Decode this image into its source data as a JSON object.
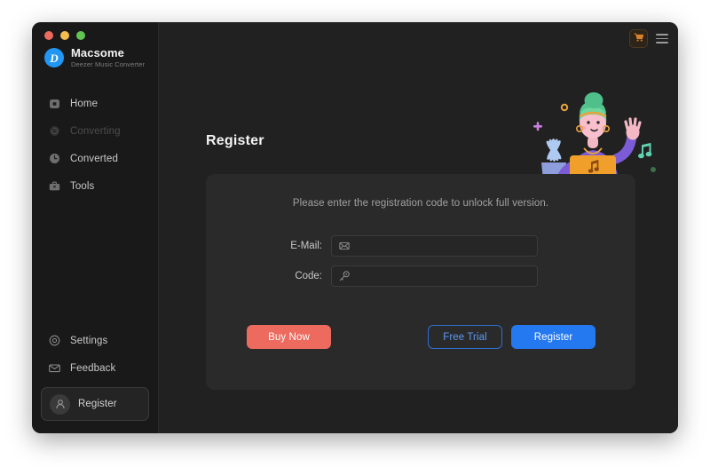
{
  "window": {
    "traffic_lights": [
      {
        "name": "close",
        "color": "#ec6a5e"
      },
      {
        "name": "minimize",
        "color": "#f4bd4f"
      },
      {
        "name": "maximize",
        "color": "#61c554"
      }
    ]
  },
  "sidebar": {
    "brand": {
      "logo_letter": "D",
      "name": "Macsome",
      "subtitle": "Deezer Music Converter",
      "logo_color": "#2196f3"
    },
    "nav_top": [
      {
        "label": "Home",
        "icon": "home-icon",
        "state": "normal"
      },
      {
        "label": "Converting",
        "icon": "converting-icon",
        "state": "disabled"
      },
      {
        "label": "Converted",
        "icon": "converted-icon",
        "state": "normal"
      },
      {
        "label": "Tools",
        "icon": "tools-icon",
        "state": "normal"
      }
    ],
    "nav_bottom": [
      {
        "label": "Settings",
        "icon": "settings-icon"
      },
      {
        "label": "Feedback",
        "icon": "feedback-icon"
      }
    ],
    "register_nav": {
      "label": "Register",
      "icon": "user-avatar-icon"
    }
  },
  "topbar": {
    "cart_icon": "shopping-cart-icon",
    "menu_icon": "hamburger-menu-icon",
    "cart_color": "#d9822b"
  },
  "main": {
    "page_title": "Register",
    "illustration": "person-waving-with-laptop-illustration"
  },
  "card": {
    "hint": "Please enter the registration code to unlock full version.",
    "fields": [
      {
        "label": "E-Mail:",
        "icon": "envelope-icon",
        "value": "",
        "placeholder": ""
      },
      {
        "label": "Code:",
        "icon": "key-icon",
        "value": "",
        "placeholder": ""
      }
    ],
    "buttons": {
      "buy_now": {
        "label": "Buy Now",
        "color": "#ec6a5e"
      },
      "free_trial": {
        "label": "Free Trial",
        "color": "#5b9bf3"
      },
      "register": {
        "label": "Register",
        "color": "#2478f0"
      }
    }
  }
}
